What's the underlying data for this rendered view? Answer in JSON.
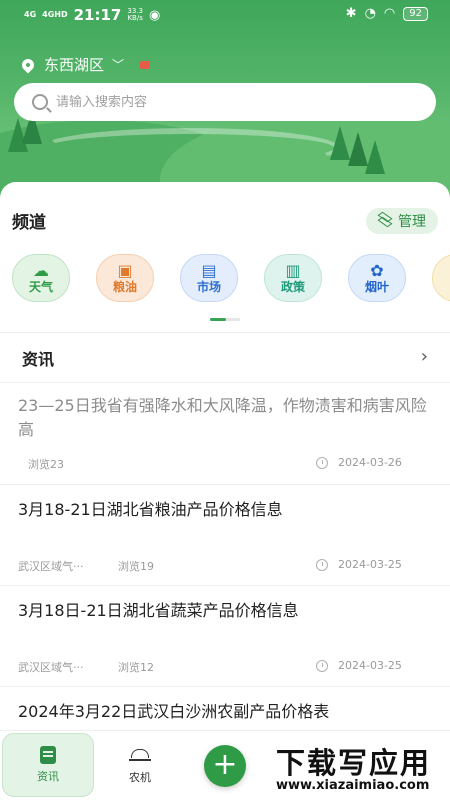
{
  "status_bar": {
    "signal1": "4G",
    "signal2": "4GHD",
    "time": "21:17",
    "speed_value": "33.3",
    "speed_unit": "KB/s",
    "battery": "92"
  },
  "header": {
    "location": "东西湖区"
  },
  "search": {
    "placeholder": "请输入搜索内容"
  },
  "channel_section": {
    "title": "频道",
    "manage_label": "管理",
    "items": [
      {
        "label": "天气",
        "icon": "weather-icon",
        "glyph": "☁",
        "color": "#2f9b46"
      },
      {
        "label": "粮油",
        "icon": "grain-oil-icon",
        "glyph": "▣",
        "color": "#e07a2c"
      },
      {
        "label": "市场",
        "icon": "market-icon",
        "glyph": "▤",
        "color": "#2f6fd0"
      },
      {
        "label": "政策",
        "icon": "policy-icon",
        "glyph": "▥",
        "color": "#1f9a7a"
      },
      {
        "label": "烟叶",
        "icon": "tobacco-leaf-icon",
        "glyph": "✿",
        "color": "#2466c8"
      }
    ]
  },
  "news_section": {
    "title": "资讯",
    "articles": [
      {
        "title": "23—25日我省有强降水和大风降温，作物渍害和病害风险高",
        "source": "",
        "views": "浏览23",
        "date": "2024-03-26"
      },
      {
        "title": "3月18-21日湖北省粮油产品价格信息",
        "source": "武汉区域气···",
        "views": "浏览19",
        "date": "2024-03-25"
      },
      {
        "title": "3月18日-21日湖北省蔬菜产品价格信息",
        "source": "武汉区域气···",
        "views": "浏览12",
        "date": "2024-03-25"
      },
      {
        "title": "2024年3月22日武汉白沙洲农副产品价格表",
        "source": "",
        "views": "",
        "date": ""
      }
    ]
  },
  "bottom_nav": {
    "items": [
      {
        "label": "资讯",
        "active": true
      },
      {
        "label": "农机",
        "active": false
      }
    ],
    "plus_label": "+"
  },
  "watermark": {
    "main": "下载写应用",
    "sub": "www.xiazaimiao.com"
  },
  "colors": {
    "brand_green": "#2f9b46",
    "header_green": "#4faf62"
  }
}
